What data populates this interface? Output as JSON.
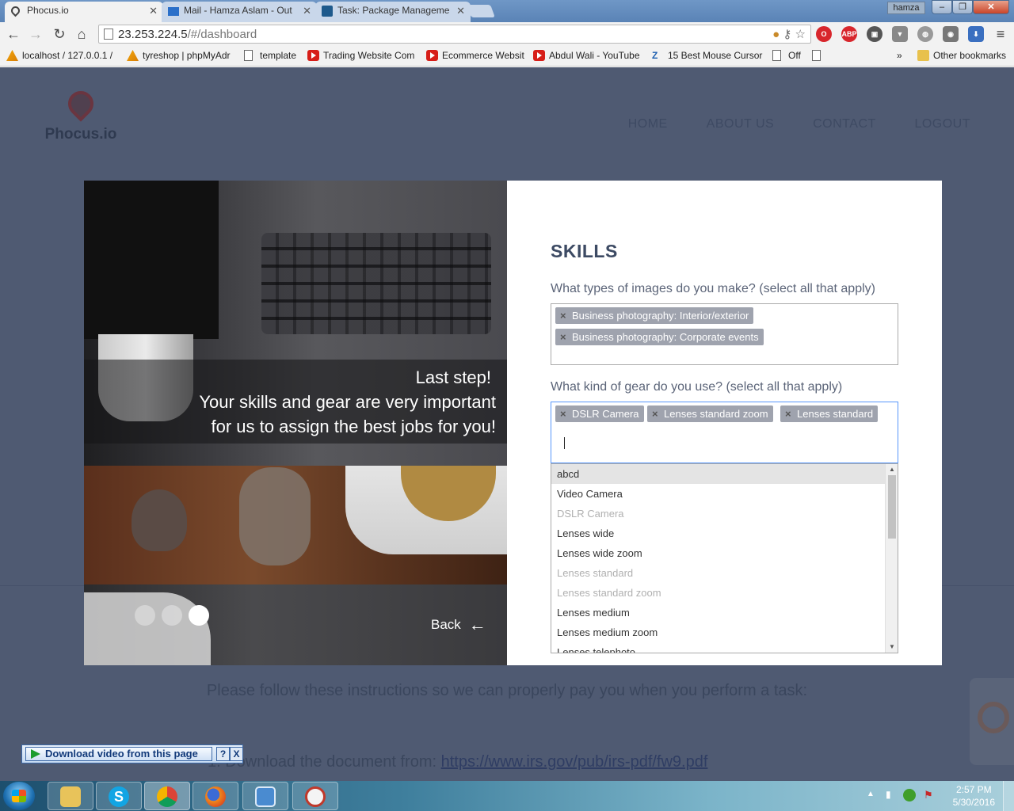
{
  "browser": {
    "tabs": [
      {
        "title": "Phocus.io",
        "active": true
      },
      {
        "title": "Mail - Hamza Aslam - Out",
        "active": false
      },
      {
        "title": "Task: Package Manageme",
        "active": false
      }
    ],
    "user_badge": "hamza",
    "url_host": "23.253.224.5",
    "url_path": "/#/dashboard",
    "extensions": [
      "opera-icon",
      "adblock-icon",
      "film-icon",
      "shield-icon",
      "globe-icon",
      "camera-icon",
      "download-arrow-icon"
    ],
    "adblock_label": "ABP"
  },
  "bookmarks": [
    {
      "label": "localhost / 127.0.0.1 /",
      "icon": "pma"
    },
    {
      "label": "tyreshop | phpMyAdr",
      "icon": "pma"
    },
    {
      "label": "template",
      "icon": "doc"
    },
    {
      "label": "Trading Website Com",
      "icon": "youtube"
    },
    {
      "label": "Ecommerce Websit",
      "icon": "youtube"
    },
    {
      "label": "Abdul Wali - YouTube",
      "icon": "youtube"
    },
    {
      "label": "15 Best Mouse Cursor",
      "icon": "link"
    },
    {
      "label": "Off",
      "icon": "doc"
    },
    {
      "label": "",
      "icon": "doc"
    }
  ],
  "bookmarks_overflow": "»",
  "other_bookmarks": "Other bookmarks",
  "site": {
    "logo_text": "Phocus.io",
    "nav": [
      "HOME",
      "ABOUT US",
      "CONTACT",
      "LOGOUT"
    ],
    "instructions_text": "Please follow these instructions so we can properly pay you when you perform a task:",
    "step_text": "1. Download the document from:",
    "step_link": "https://www.irs.gov/pub/irs-pdf/fw9.pdf"
  },
  "modal": {
    "caption_line1": "Last step!",
    "caption_line2": "Your skills and gear are very important",
    "caption_line3": "for us to assign the best jobs for you!",
    "back_label": "Back",
    "slide_count": 3,
    "active_slide": 3,
    "title": "SKILLS",
    "q1_label": "What types of images do you make? (select all that apply)",
    "q1_selected": [
      "Business photography: Interior/exterior",
      "Business photography: Corporate events"
    ],
    "q2_label": "What kind of gear do you use? (select all that apply)",
    "q2_selected": [
      "DSLR Camera",
      "Lenses standard zoom",
      "Lenses standard"
    ],
    "q2_input_value": "",
    "dropdown_options": [
      {
        "label": "abcd",
        "state": "highlighted"
      },
      {
        "label": "Video Camera",
        "state": "normal"
      },
      {
        "label": "DSLR Camera",
        "state": "disabled"
      },
      {
        "label": "Lenses wide",
        "state": "normal"
      },
      {
        "label": "Lenses wide zoom",
        "state": "normal"
      },
      {
        "label": "Lenses standard",
        "state": "disabled"
      },
      {
        "label": "Lenses standard zoom",
        "state": "disabled"
      },
      {
        "label": "Lenses medium",
        "state": "normal"
      },
      {
        "label": "Lenses medium zoom",
        "state": "normal"
      },
      {
        "label": "Lenses telephoto",
        "state": "normal"
      }
    ]
  },
  "plugin": {
    "download_label": "Download video from this page",
    "help_label": "?",
    "close_label": "X"
  },
  "taskbar": {
    "apps": [
      "file-explorer-icon",
      "skype-icon",
      "chrome-icon",
      "firefox-icon",
      "control-panel-icon",
      "snipping-tool-icon"
    ],
    "time": "2:57 PM",
    "date": "5/30/2016"
  },
  "colors": {
    "overlay_bg": "#4f5a72",
    "skills_title": "#3c4a63",
    "chip_bg": "#9fa3ae",
    "focus_border": "#5897fb"
  }
}
